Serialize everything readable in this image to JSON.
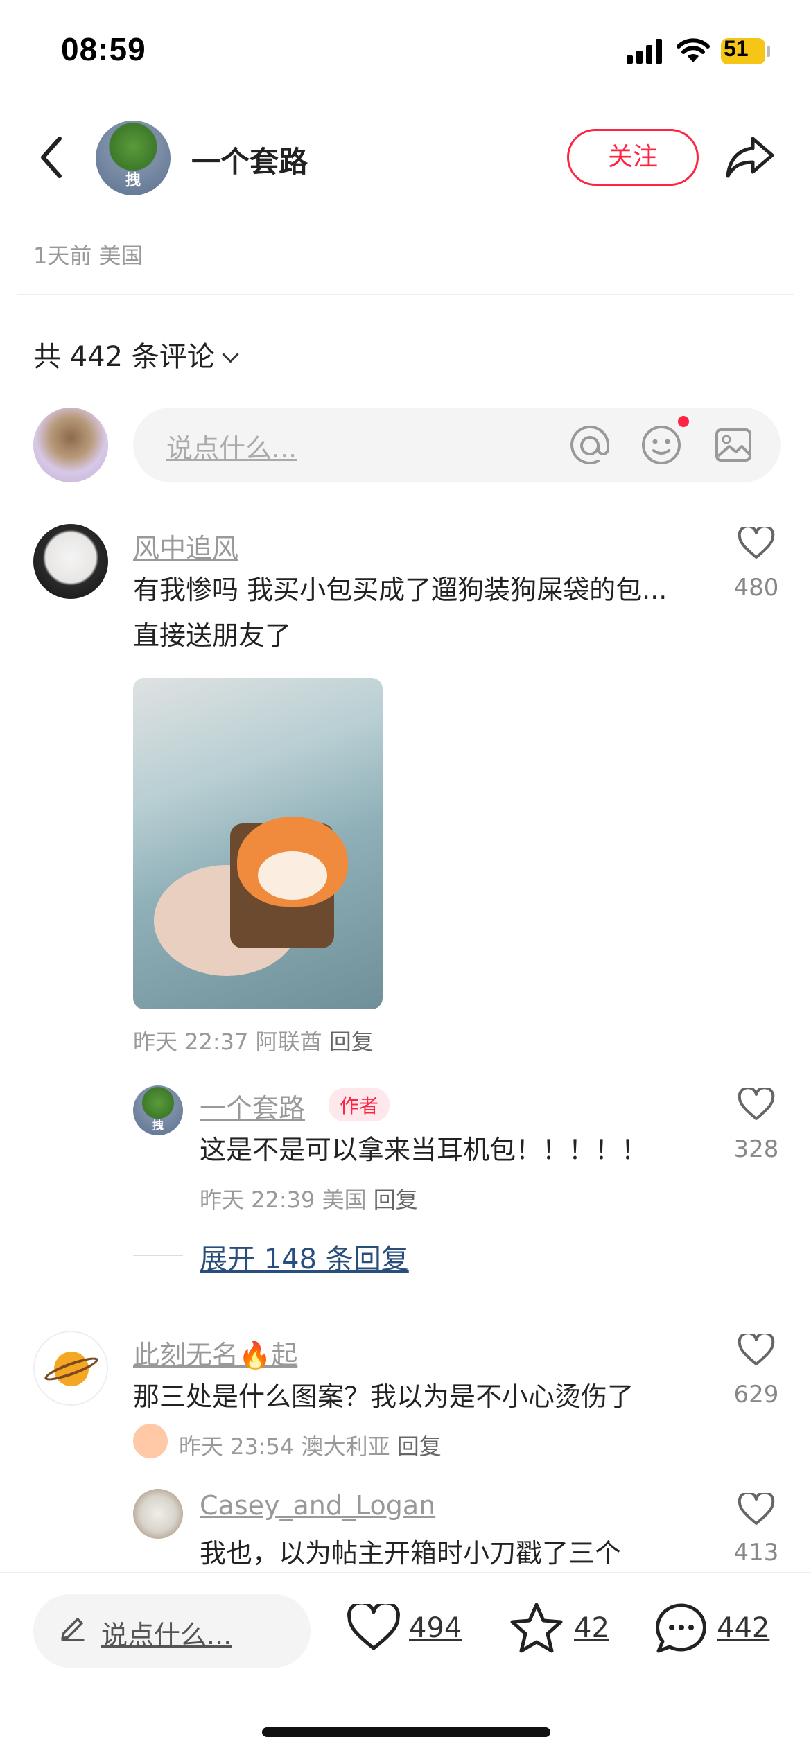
{
  "status_bar": {
    "time": "08:59",
    "battery": "51"
  },
  "header": {
    "author": "一个套路",
    "avatar_badge": "拽",
    "follow_label": "关注"
  },
  "post_meta": "1天前 美国",
  "comments_header": {
    "count_text": "共 442 条评论"
  },
  "comment_input": {
    "placeholder": "说点什么..."
  },
  "comments": [
    {
      "user": "风中追风",
      "text": "有我惨吗 我买小包买成了遛狗装狗屎袋的包...直接送朋友了",
      "likes": "480",
      "meta": "昨天 22:37 阿联酋",
      "reply_label": "回复",
      "replies": [
        {
          "user": "一个套路",
          "tag": "作者",
          "text": "这是不是可以拿来当耳机包！！！！！",
          "likes": "328",
          "meta": "昨天 22:39 美国",
          "reply_label": "回复"
        }
      ],
      "expand_label": "展开 148 条回复"
    },
    {
      "user": "此刻无名🔥起",
      "text": "那三处是什么图案？我以为是不小心烫伤了",
      "likes": "629",
      "meta": "昨天 23:54 澳大利亚",
      "reply_label": "回复",
      "replies": [
        {
          "user": "Casey_and_Logan",
          "text": "我也，以为帖主开箱时小刀戳了三个",
          "likes": "413"
        }
      ]
    }
  ],
  "bottom_bar": {
    "placeholder": "说点什么...",
    "likes": "494",
    "favorites": "42",
    "comments": "442"
  },
  "colors": {
    "accent": "#ff2442",
    "link": "#2a4e7c"
  }
}
